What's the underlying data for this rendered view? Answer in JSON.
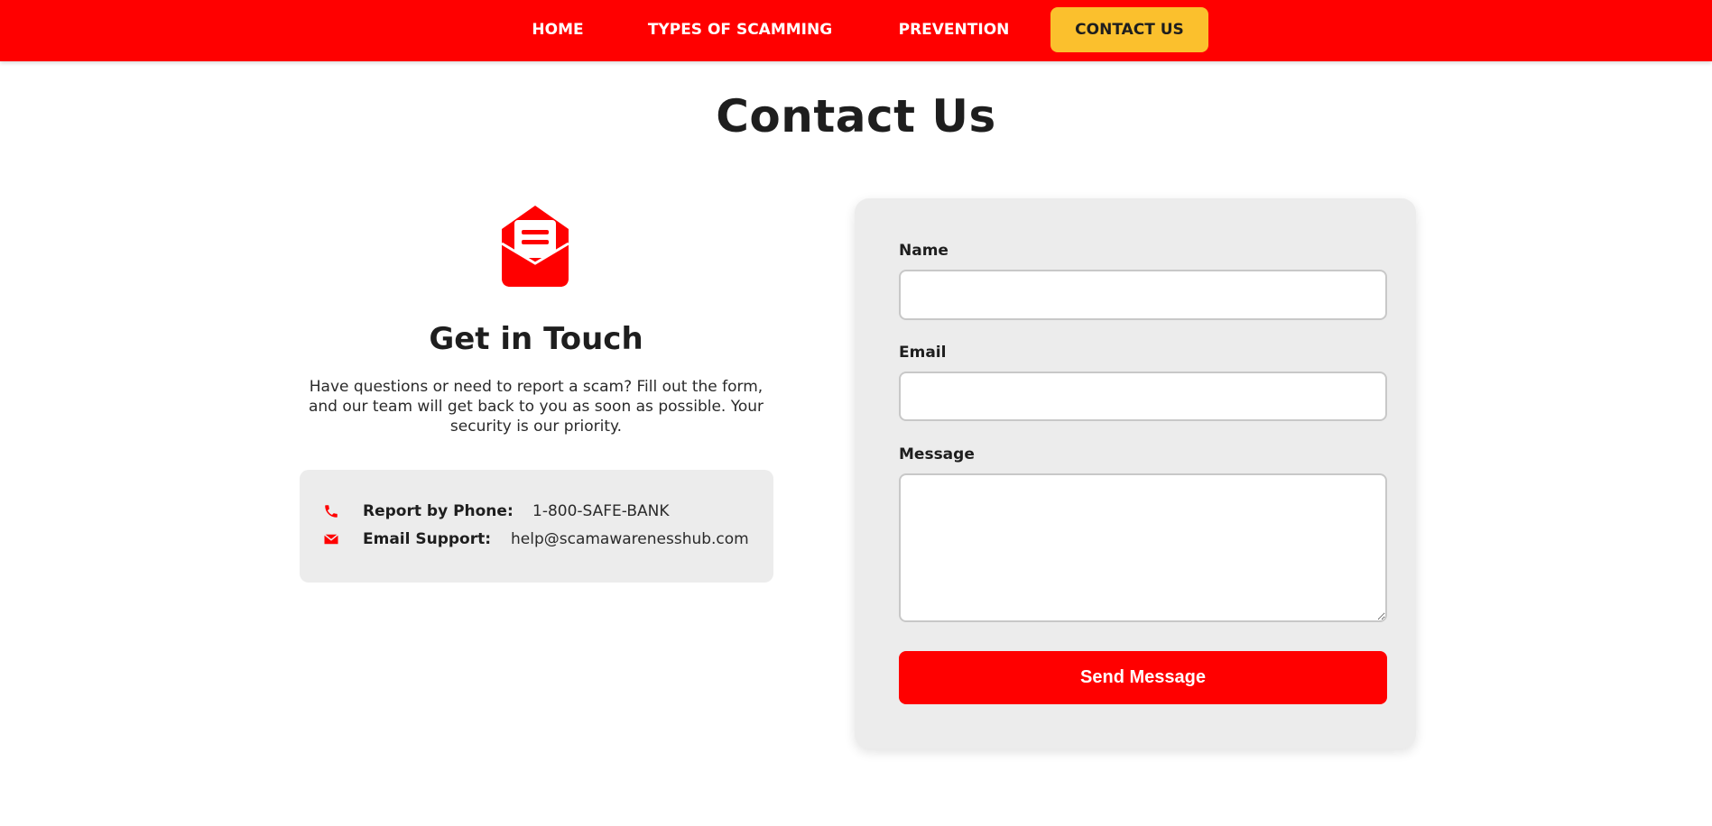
{
  "nav": {
    "items": [
      {
        "label": "HOME"
      },
      {
        "label": "TYPES OF SCAMMING"
      },
      {
        "label": "PREVENTION"
      },
      {
        "label": "CONTACT US",
        "active": true
      }
    ]
  },
  "page_title": "Contact Us",
  "get_in_touch": {
    "icon": "envelope-open-icon",
    "title": "Get in Touch",
    "description": "Have questions or need to report a scam? Fill out the form, and our team will get back to you as soon as possible. Your security is our priority."
  },
  "contact_info": {
    "phone": {
      "icon": "phone-icon",
      "label": "Report by Phone:",
      "value": "1-800-SAFE-BANK"
    },
    "email": {
      "icon": "envelope-icon",
      "label": "Email Support:",
      "value": "help@scamawarenesshub.com"
    }
  },
  "form": {
    "name_label": "Name",
    "name_value": "",
    "email_label": "Email",
    "email_value": "",
    "message_label": "Message",
    "message_value": "",
    "submit_label": "Send Message"
  },
  "colors": {
    "brand_red": "#ff0000",
    "accent_yellow": "#fbc02d",
    "panel_gray": "#ececec",
    "text_dark": "#1e1e1e"
  }
}
